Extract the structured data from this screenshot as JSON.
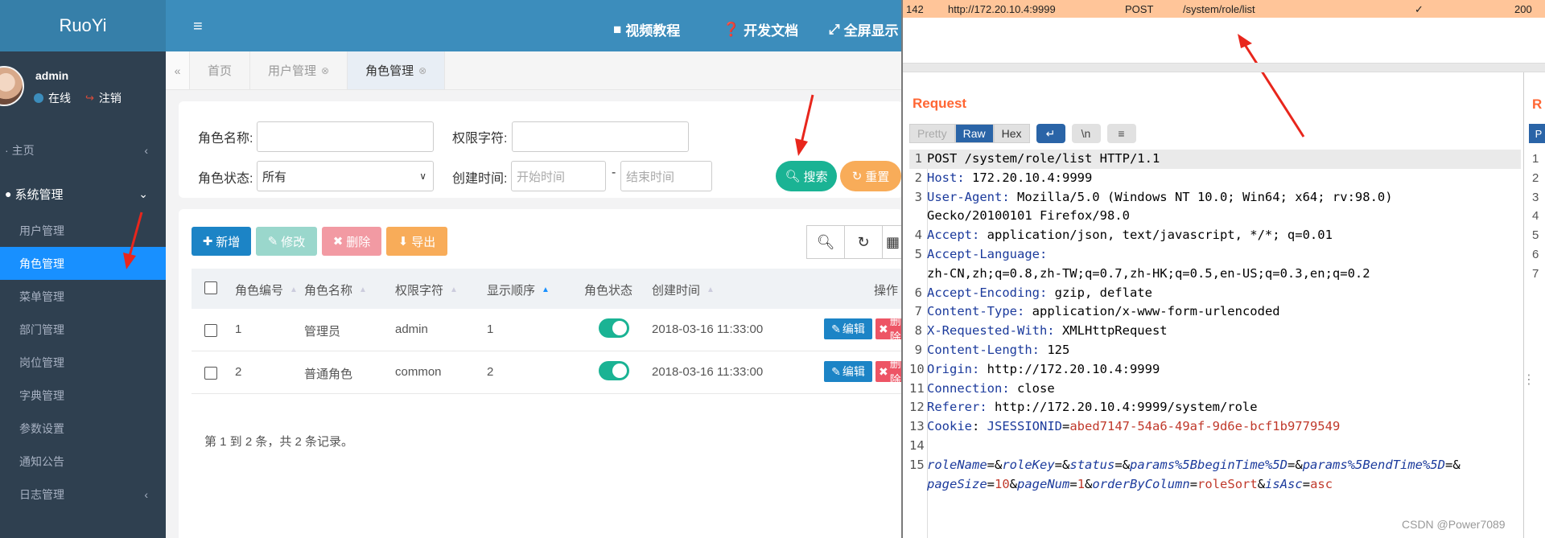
{
  "sidebar": {
    "logo": "RuoYi",
    "user_name": "admin",
    "status": "在线",
    "logout": "注销",
    "home": "主页",
    "system_group": "系统管理",
    "items": [
      "用户管理",
      "角色管理",
      "菜单管理",
      "部门管理",
      "岗位管理",
      "字典管理",
      "参数设置",
      "通知公告",
      "日志管理"
    ]
  },
  "topbar": {
    "video": "视频教程",
    "docs": "开发文档",
    "fullscreen": "全屏显示"
  },
  "tabs": [
    "首页",
    "用户管理",
    "角色管理"
  ],
  "search": {
    "role_name_label": "角色名称:",
    "role_key_label": "权限字符:",
    "status_label": "角色状态:",
    "status_value": "所有",
    "created_label": "创建时间:",
    "start_placeholder": "开始时间",
    "end_placeholder": "结束时间",
    "dash": "-",
    "search_btn": "搜索",
    "reset_btn": "重置"
  },
  "toolbar": {
    "add": "新增",
    "edit": "修改",
    "delete": "删除",
    "export": "导出"
  },
  "table": {
    "headers": [
      "角色编号",
      "角色名称",
      "权限字符",
      "显示顺序",
      "角色状态",
      "创建时间",
      "操作"
    ],
    "rows": [
      {
        "id": "1",
        "name": "管理员",
        "key": "admin",
        "sort": "1",
        "created": "2018-03-16 11:33:00"
      },
      {
        "id": "2",
        "name": "普通角色",
        "key": "common",
        "sort": "2",
        "created": "2018-03-16 11:33:00"
      }
    ],
    "edit": "编辑",
    "delete": "删除",
    "pager": "第 1 到 2 条，共 2 条记录。"
  },
  "burp": {
    "history": {
      "num": "142",
      "host": "http://172.20.10.4:9999",
      "method": "POST",
      "url": "/system/role/list",
      "check": "✓",
      "status": "200"
    },
    "request_title": "Request",
    "view_tabs": [
      "Pretty",
      "Raw",
      "Hex"
    ],
    "newline_icon": "\\n",
    "lines": [
      {
        "n": "1",
        "key": "",
        "val": "POST /system/role/list HTTP/1.1"
      },
      {
        "n": "2",
        "key": "Host",
        "val": " 172.20.10.4:9999"
      },
      {
        "n": "3",
        "key": "User-Agent",
        "val": " Mozilla/5.0 (Windows NT 10.0; Win64; x64; rv:98.0)"
      },
      {
        "n": "",
        "key": "",
        "val": "Gecko/20100101 Firefox/98.0"
      },
      {
        "n": "4",
        "key": "Accept",
        "val": " application/json, text/javascript, */*; q=0.01"
      },
      {
        "n": "5",
        "key": "Accept-Language",
        "val": ""
      },
      {
        "n": "",
        "key": "",
        "val": "zh-CN,zh;q=0.8,zh-TW;q=0.7,zh-HK;q=0.5,en-US;q=0.3,en;q=0.2"
      },
      {
        "n": "6",
        "key": "Accept-Encoding",
        "val": " gzip, deflate"
      },
      {
        "n": "7",
        "key": "Content-Type",
        "val": " application/x-www-form-urlencoded"
      },
      {
        "n": "8",
        "key": "X-Requested-With",
        "val": " XMLHttpRequest"
      },
      {
        "n": "9",
        "key": "Content-Length",
        "val": " 125"
      },
      {
        "n": "10",
        "key": "Origin",
        "val": " http://172.20.10.4:9999"
      },
      {
        "n": "11",
        "key": "Connection",
        "val": " close"
      },
      {
        "n": "12",
        "key": "Referer",
        "val": " http://172.20.10.4:9999/system/role"
      }
    ],
    "cookie_line": {
      "n": "13",
      "key": "Cookie",
      "name": "JSESSIONID",
      "value": "abed7147-54a6-49af-9d6e-bcf1b9779549"
    },
    "blank_line": "14",
    "body_line_num": "15",
    "body_line1": "roleName=&roleKey=&status=&params%5BbeginTime%5D=&params%5BendTime%5D=&",
    "body_line2": "pageSize=10&pageNum=1&orderByColumn=roleSort&isAsc=asc",
    "stub_r": "R",
    "stub_p": "P",
    "stub_nums": [
      "1",
      "2",
      "3",
      "4",
      "5",
      "6",
      "7"
    ],
    "kebab": "⋮",
    "watermark": "CSDN @Power7089"
  }
}
